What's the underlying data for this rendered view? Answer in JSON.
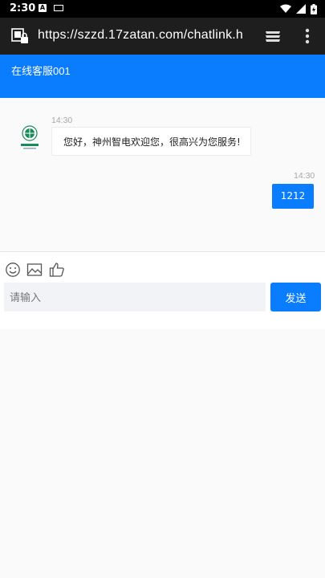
{
  "status_bar": {
    "time": "2:30",
    "icons": [
      "a-notification-icon",
      "keyboard-notification-icon",
      "wifi-icon",
      "signal-icon",
      "battery-icon"
    ]
  },
  "browser": {
    "url": "https://szzd.17zatan.com/chatlink.h"
  },
  "chat": {
    "title": "在线客服001",
    "messages": [
      {
        "side": "left",
        "time": "14:30",
        "text": "您好，神州智电欢迎您，很高兴为您服务!"
      },
      {
        "side": "right",
        "time": "14:30",
        "text": "1212"
      }
    ]
  },
  "composer": {
    "placeholder": "请输入",
    "value": "",
    "send_label": "发送",
    "tools": [
      "emoji-icon",
      "image-icon",
      "thumbs-up-icon"
    ]
  },
  "colors": {
    "accent": "#0a7dff",
    "browser_bar": "#1e1e1e",
    "status_bar": "#000000"
  }
}
